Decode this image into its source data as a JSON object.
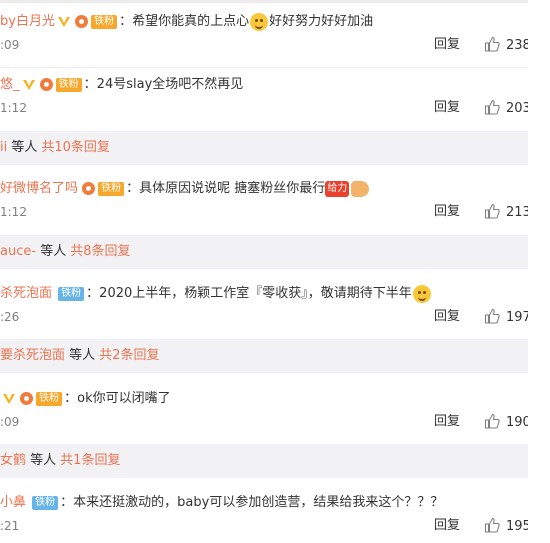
{
  "comments": [
    {
      "username": "by白月光",
      "badge": "铁粉",
      "badge_color": "orange",
      "pre_emoji": "希望你能真的上点心",
      "post_emoji": "好好努力好好加油",
      "emoji": "smile-emoji",
      "time": ":09",
      "reply": "回复",
      "likes": "238"
    },
    {
      "username": "悠_",
      "badge": "铁粉",
      "badge_color": "orange",
      "text": "24号slay全场吧不然再见",
      "time": "1:12",
      "reply": "回复",
      "likes": "203"
    },
    {
      "username": "好微博名了吗",
      "badge": "铁粉",
      "badge_color": "orange",
      "text": "具体原因说说呢 搪塞粉丝你最行",
      "sticker": "给力",
      "time": "1:12",
      "reply": "回复",
      "likes": "213"
    },
    {
      "username": "杀死泡面",
      "badge": "铁粉",
      "badge_color": "blue",
      "text": "2020上半年，杨颖工作室『零收获』，敬请期待下半年",
      "emoji": "smile-emoji",
      "time": ":26",
      "reply": "回复",
      "likes": "197"
    },
    {
      "username": "",
      "badge": "铁粉",
      "badge_color": "orange",
      "text": "ok你可以闭嘴了",
      "time": ":09",
      "reply": "回复",
      "likes": "190"
    },
    {
      "username": "小鼻",
      "badge": "铁粉",
      "badge_color": "blue",
      "text": "本来还挺激动的，baby可以参加创造营，结果给我来这个？？？",
      "time": ":21",
      "reply": "回复",
      "likes": "195"
    }
  ],
  "threads": [
    {
      "user": "ii",
      "suffix": "等人",
      "more": "共10条回复"
    },
    {
      "user": "auce-",
      "suffix": "等人",
      "more": "共8条回复"
    },
    {
      "user": "要杀死泡面",
      "suffix": "等人",
      "more": "共2条回复"
    },
    {
      "user": "女鹤",
      "suffix": "等人",
      "more": "共1条回复"
    }
  ],
  "colors": {
    "accent": "#eb7350",
    "thread_bg": "#f2f2f5",
    "badge_orange": "#f7a72b",
    "badge_blue": "#67b5e8"
  }
}
